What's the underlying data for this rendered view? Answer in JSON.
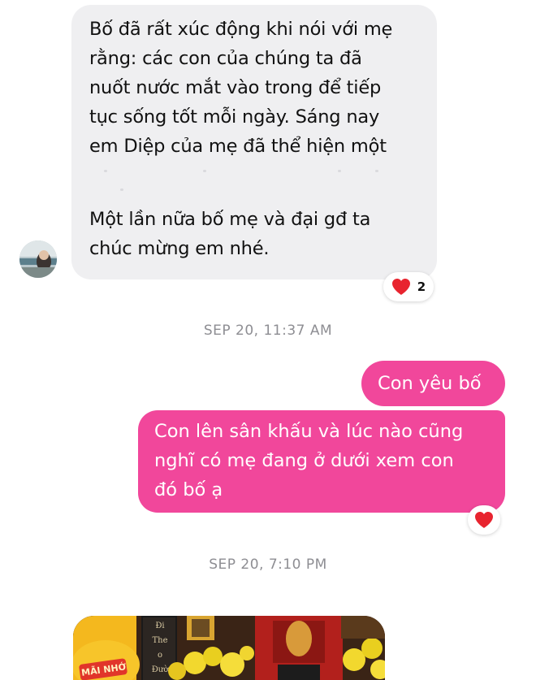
{
  "incoming_message": {
    "lines": [
      "Bố đã rất xúc động khi nói với mẹ",
      "rằng: các con của chúng ta đã",
      "nuốt nước mắt vào trong để tiếp",
      "tục sống tốt mỗi ngày. Sáng nay",
      "em Diệp của mẹ đã thể hiện một",
      "Một lần nữa bố mẹ và đại gđ ta",
      "chúc mừng em nhé."
    ],
    "reaction_count": "2"
  },
  "timestamps": [
    "SEP 20, 11:37 AM",
    "SEP 20, 7:10 PM"
  ],
  "outgoing_messages": [
    {
      "lines": [
        "Con yêu bố"
      ]
    },
    {
      "lines": [
        "Con lên sân khấu và lúc nào cũng",
        "nghĩ có mẹ đang ở dưới xem con",
        "đó bố ạ"
      ]
    }
  ],
  "photo": {
    "sign_text": "MÃI NHỚ",
    "scroll_text": "Đi Theo Đường"
  },
  "colors": {
    "outgoing_bubble": "#f1479b",
    "incoming_bubble": "#efeff1",
    "heart": "#e8242f",
    "timestamp": "#8e8e93"
  },
  "icons": [
    "heart-icon",
    "avatar"
  ]
}
